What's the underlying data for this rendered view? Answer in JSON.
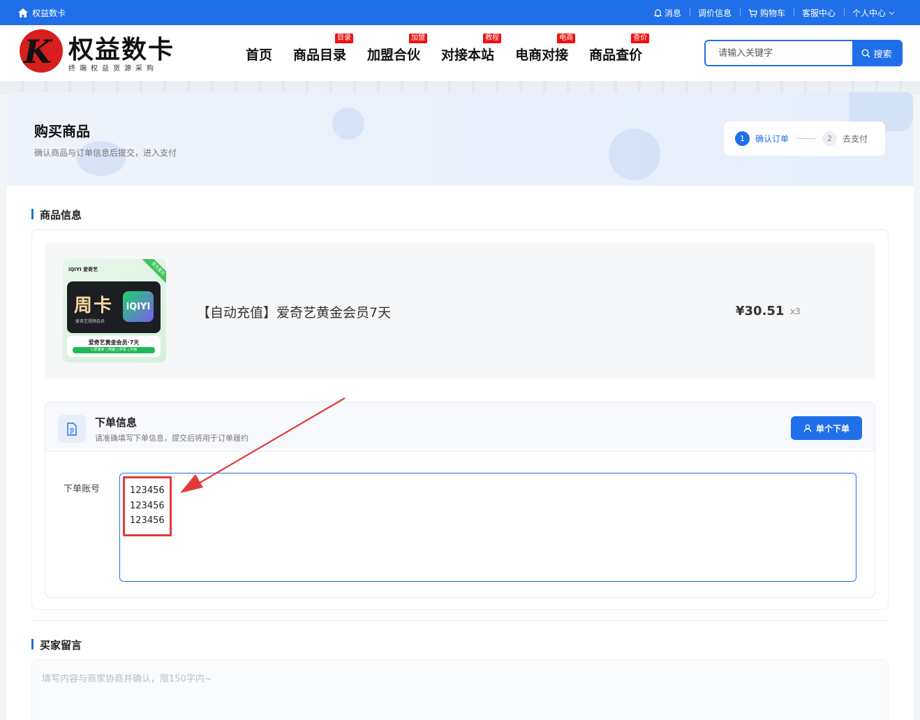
{
  "topbar": {
    "home_label": "权益数卡",
    "links": [
      "消息",
      "调价信息",
      "购物车",
      "客服中心",
      "个人中心"
    ]
  },
  "header": {
    "logo_title": "权益数卡",
    "logo_subtitle": "终端权益货源采购",
    "nav": [
      {
        "label": "首页",
        "tag": ""
      },
      {
        "label": "商品目录",
        "tag": "目录"
      },
      {
        "label": "加盟合伙",
        "tag": "加盟"
      },
      {
        "label": "对接本站",
        "tag": "教程"
      },
      {
        "label": "电商对接",
        "tag": "电商"
      },
      {
        "label": "商品查价",
        "tag": "查价"
      }
    ],
    "search_placeholder": "请输入关键字",
    "search_button": "搜索"
  },
  "hero": {
    "title": "购买商品",
    "subtitle": "确认商品与订单信息后提交，进入支付",
    "steps": [
      {
        "num": "1",
        "label": "确认订单"
      },
      {
        "num": "2",
        "label": "去支付"
      }
    ]
  },
  "product_section": {
    "title": "商品信息",
    "thumb": {
      "brand": "iQIYI 爱奇艺",
      "corner": "官方直充",
      "card_title": "周卡",
      "card_sub": "爱奇艺视频会员",
      "card_icon": "iQIYI",
      "bottom_title": "爱奇艺黄金会员·7天",
      "bottom_tags": "三屏通用 ◻电脑 ◻手机 ◻平板"
    },
    "name": "【自动充值】爱奇艺黄金会员7天",
    "price": "¥30.51",
    "qty": "x3"
  },
  "order": {
    "title": "下单信息",
    "subtitle": "请准确填写下单信息，提交后将用于订单履约",
    "single_button": "单个下单",
    "account_label": "下单账号",
    "account_value": "123456\n123456\n123456"
  },
  "buyer_message": {
    "title": "买家留言",
    "placeholder": "填写内容与商家协商并确认，限150字内~"
  },
  "colors": {
    "primary": "#1f6fe8",
    "tag_red": "#ee1111",
    "annotation_red": "#e23a3a"
  }
}
